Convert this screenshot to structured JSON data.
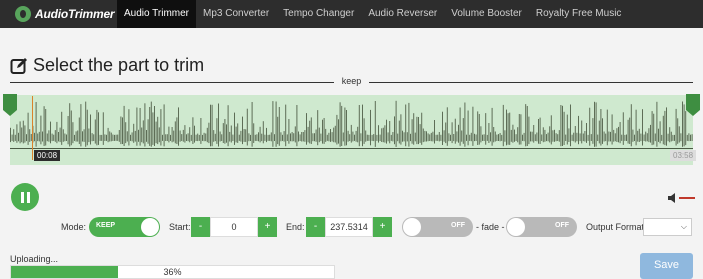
{
  "brand": {
    "name": "AudioTrimmer"
  },
  "nav": {
    "items": [
      {
        "label": "Audio Trimmer",
        "active": true
      },
      {
        "label": "Mp3 Converter",
        "active": false
      },
      {
        "label": "Tempo Changer",
        "active": false
      },
      {
        "label": "Audio Reverser",
        "active": false
      },
      {
        "label": "Volume Booster",
        "active": false
      },
      {
        "label": "Royalty Free Music",
        "active": false
      }
    ]
  },
  "page": {
    "title": "Select the part to trim",
    "section_label": "keep"
  },
  "waveform": {
    "current_time": "00:08",
    "end_time": "03:58",
    "color_selected": "#cfe9cf",
    "color_wave": "#5d6d56"
  },
  "controls": {
    "mode_label": "Mode:",
    "mode_value": "KEEP",
    "start_label": "Start:",
    "start_value": "0",
    "end_label": "End:",
    "end_value": "237.5314",
    "minus": "-",
    "plus": "+",
    "fade_in_toggle": "OFF",
    "fade_label": "- fade -",
    "fade_out_toggle": "OFF",
    "output_format_label": "Output Format"
  },
  "upload": {
    "label": "Uploading...",
    "percent_text": "36%",
    "progress": 0.36
  },
  "actions": {
    "save_label": "Save"
  },
  "colors": {
    "accent": "#4caf50",
    "nav_bg": "#2d2d2d"
  }
}
